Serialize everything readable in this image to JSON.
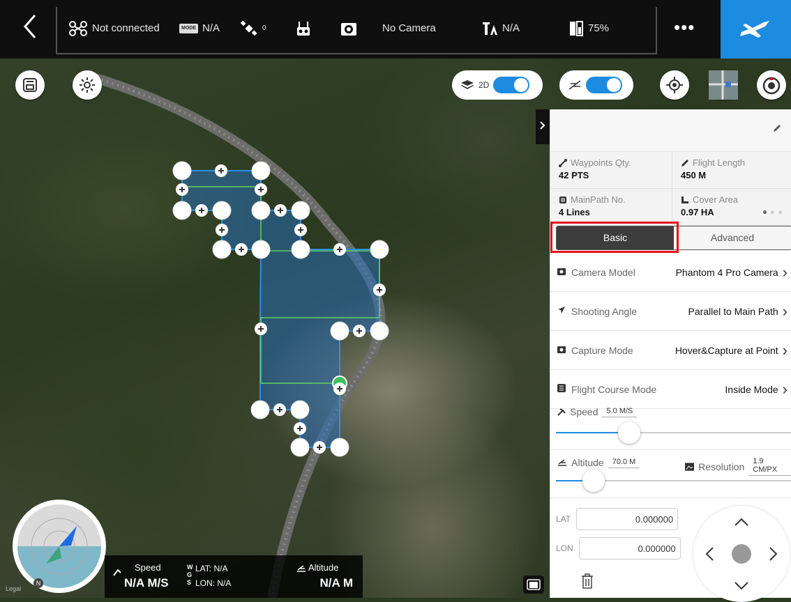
{
  "topbar": {
    "connection": "Not connected",
    "mode_badge": "MODE",
    "mode_value": "N/A",
    "gps_count": "0",
    "camera": "No Camera",
    "signal": "N/A",
    "battery": "75%",
    "more": "•••"
  },
  "map_controls": {
    "view_toggle_label": "2D"
  },
  "panel": {
    "stats": [
      {
        "label": "Waypoints Qty.",
        "value": "42 PTS",
        "icon": "waypoint-icon"
      },
      {
        "label": "Flight Length",
        "value": "450 M",
        "icon": "pencil-icon"
      },
      {
        "label": "MainPath No.",
        "value": "4 Lines",
        "icon": "mainpath-icon"
      },
      {
        "label": "Cover Area",
        "value": "0.97 HA",
        "icon": "area-icon"
      }
    ],
    "tabs": {
      "basic": "Basic",
      "advanced": "Advanced"
    },
    "rows": [
      {
        "label": "Camera Model",
        "value": "Phantom 4 Pro Camera"
      },
      {
        "label": "Shooting Angle",
        "value": "Parallel to Main Path"
      },
      {
        "label": "Capture Mode",
        "value": "Hover&Capture at Point"
      },
      {
        "label": "Flight Course Mode",
        "value": "Inside Mode"
      }
    ],
    "speed": {
      "label": "Speed",
      "value": "5.0 M/S",
      "level": 0.31
    },
    "altitude": {
      "label": "Altitude",
      "value": "70.0 M",
      "level": 0.16
    },
    "resolution": {
      "label": "Resolution",
      "value": "1.9 CM/PX"
    },
    "lat": {
      "label": "LAT",
      "value": "0.000000"
    },
    "lon": {
      "label": "LON",
      "value": "0.000000"
    }
  },
  "bottom": {
    "speed_label": "Speed",
    "speed_value": "N/A M/S",
    "gps_w": "W",
    "gps_g": "G",
    "gps_s": "S",
    "lat": "LAT: N/A",
    "lon": "LON: N/A",
    "altitude_label": "Altitude",
    "altitude_value": "N/A M"
  },
  "compass": {
    "north": "N"
  },
  "legal": "Legal"
}
